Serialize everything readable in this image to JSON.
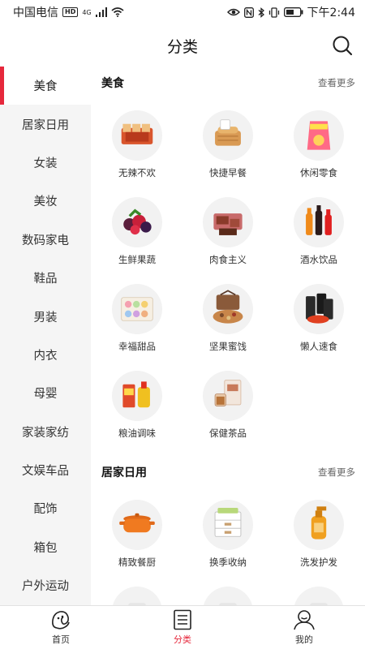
{
  "status_bar": {
    "carrier": "中国电信",
    "hd": "HD",
    "net": "4G",
    "time": "下午2:44"
  },
  "header": {
    "title": "分类"
  },
  "sidebar": {
    "items": [
      {
        "label": "美食"
      },
      {
        "label": "居家日用"
      },
      {
        "label": "女装"
      },
      {
        "label": "美妆"
      },
      {
        "label": "数码家电"
      },
      {
        "label": "鞋品"
      },
      {
        "label": "男装"
      },
      {
        "label": "内衣"
      },
      {
        "label": "母婴"
      },
      {
        "label": "家装家纺"
      },
      {
        "label": "文娱车品"
      },
      {
        "label": "配饰"
      },
      {
        "label": "箱包"
      },
      {
        "label": "户外运动"
      }
    ],
    "active_index": 0
  },
  "sections": [
    {
      "title": "美食",
      "more": "查看更多",
      "items": [
        {
          "label": "无辣不欢",
          "icon": "spicy-snack-icon"
        },
        {
          "label": "快捷早餐",
          "icon": "bread-icon"
        },
        {
          "label": "休闲零食",
          "icon": "chips-icon"
        },
        {
          "label": "生鲜果蔬",
          "icon": "berries-icon"
        },
        {
          "label": "肉食主义",
          "icon": "meat-icon"
        },
        {
          "label": "酒水饮品",
          "icon": "drinks-icon"
        },
        {
          "label": "幸福甜品",
          "icon": "macaron-icon"
        },
        {
          "label": "坚果蜜饯",
          "icon": "nuts-icon"
        },
        {
          "label": "懒人速食",
          "icon": "noodles-icon"
        },
        {
          "label": "粮油调味",
          "icon": "oil-icon"
        },
        {
          "label": "保健茶品",
          "icon": "tea-icon"
        }
      ]
    },
    {
      "title": "居家日用",
      "more": "查看更多",
      "items": [
        {
          "label": "精致餐厨",
          "icon": "pot-icon"
        },
        {
          "label": "换季收纳",
          "icon": "storage-box-icon"
        },
        {
          "label": "洗发护发",
          "icon": "shampoo-icon"
        },
        {
          "label": "",
          "icon": "product-icon"
        },
        {
          "label": "",
          "icon": "product-icon"
        },
        {
          "label": "",
          "icon": "product-icon"
        }
      ]
    }
  ],
  "tabbar": {
    "tabs": [
      {
        "label": "首页"
      },
      {
        "label": "分类"
      },
      {
        "label": "我的"
      }
    ],
    "active_index": 1
  },
  "colors": {
    "accent": "#e6283c",
    "sidebar_bg": "#f5f5f5"
  }
}
